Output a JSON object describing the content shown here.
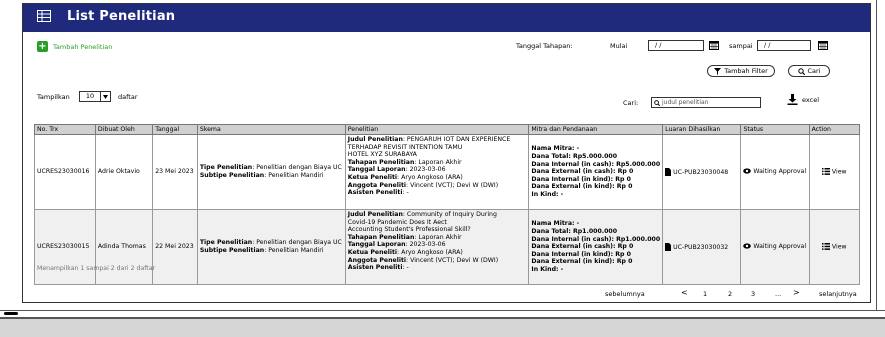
{
  "header": {
    "title": "List Penelitian"
  },
  "toolbar": {
    "add_label": "Tambah Penelitian",
    "date_label": "Tanggal Tahapan:",
    "from_label": "Mulai",
    "from_value": "/  /",
    "to_label": "sampai",
    "to_value": "/  /",
    "filter_label": "Tambah Filter",
    "search_label": "Cari"
  },
  "listing": {
    "show_label": "Tampilkan",
    "show_value": "10",
    "unit_label": "daftar",
    "search_label": "Cari:",
    "search_placeholder": "judul penelitian",
    "excel_label": "excel"
  },
  "table": {
    "columns": [
      "No. Trx",
      "Dibuat Oleh",
      "Tanggal",
      "Skema",
      "Penelitian",
      "Mitra dan Pendanaan",
      "Luaran Dihasilkan",
      "Status",
      "Action"
    ],
    "rows": [
      {
        "no": "UCRES23030016",
        "by": "Adrie Oktavio",
        "date": "23 Mei 2023",
        "skema_type_label": "Tipe Penelitian",
        "skema_type": ": Penelitian dengan Biaya UC",
        "skema_sub_label": "Subtipe Penelitian",
        "skema_sub": ": Penelitian Mandiri",
        "judul_label": "Judul Penelitian",
        "judul": ": PENGARUH IOT DAN EXPERIENCE",
        "judul2": "TERHADAP REVISIT INTENTION TAMU",
        "judul3": "HOTEL XYZ SURABAYA",
        "tahapan_label": "Tahapan Penelitian",
        "tahapan": ": Laporan Akhir",
        "tgl_label": "Tanggal Laporan",
        "tgl": ": 2023-03-06",
        "ketua_label": "Ketua Peneliti",
        "ketua": ": Aryo Angkoso (ARA)",
        "anggota_label": "Anggota Peneliti",
        "anggota": ": Vincent (VCT); Devi W (DWI)",
        "asisten_label": "Asisten Peneliti",
        "asisten": ": -",
        "mitra": [
          "Nama Mitra: -",
          "Dana Total: Rp5.000.000",
          "Dana Internal (in cash): Rp5.000.000",
          "Dana External (in cash): Rp 0",
          "Dana Internal (in kind): Rp 0",
          "Dana External (in kind): Rp 0",
          "In Kind: -"
        ],
        "luaran": "UC-PUB23030048",
        "status": "Waiting Approval",
        "action": "View"
      },
      {
        "no": "UCRES23030015",
        "by": "Adinda Thomas",
        "date": "22 Mei 2023",
        "skema_type_label": "Tipe Penelitian",
        "skema_type": ": Penelitian dengan Biaya UC",
        "skema_sub_label": "Subtipe Penelitian",
        "skema_sub": ": Penelitian Mandiri",
        "judul_label": "Judul Penelitian",
        "judul": ": Community of Inquiry During",
        "judul2": "Covid-19 Pandemic Does It Aect",
        "judul3": "Accounting Student's Professional Skill?",
        "tahapan_label": "Tahapan Penelitian",
        "tahapan": ": Laporan Akhir",
        "tgl_label": "Tanggal Laporan",
        "tgl": ": 2023-03-06",
        "ketua_label": "Ketua Peneliti",
        "ketua": ": Aryo Angkoso (ARA)",
        "anggota_label": "Anggota Peneliti",
        "anggota": ": Vincent (VCT); Devi W (DWI)",
        "asisten_label": "Asisten Peneliti",
        "asisten": ": -",
        "mitra": [
          "Nama Mitra: -",
          "Dana Total: Rp1.000.000",
          "Dana Internal (in cash): Rp1.000.000",
          "Dana External (in cash): Rp 0",
          "Dana Internal (in kind): Rp 0",
          "Dana External (in kind): Rp 0",
          "In Kind: -"
        ],
        "luaran": "UC-PUB23030032",
        "status": "Waiting Approval",
        "action": "View"
      }
    ]
  },
  "footer": {
    "summary": "Menampilkan 1 sampai 2 dari 2 daftar"
  },
  "pagination": {
    "prev": "sebelumnya",
    "prev_arrow": "<",
    "pages": [
      "1",
      "2",
      "3"
    ],
    "ellipsis": "...",
    "next_arrow": ">",
    "next": "selanjutnya"
  },
  "colors": {
    "header": "#1f2a7c",
    "add": "#2a9d2a"
  }
}
